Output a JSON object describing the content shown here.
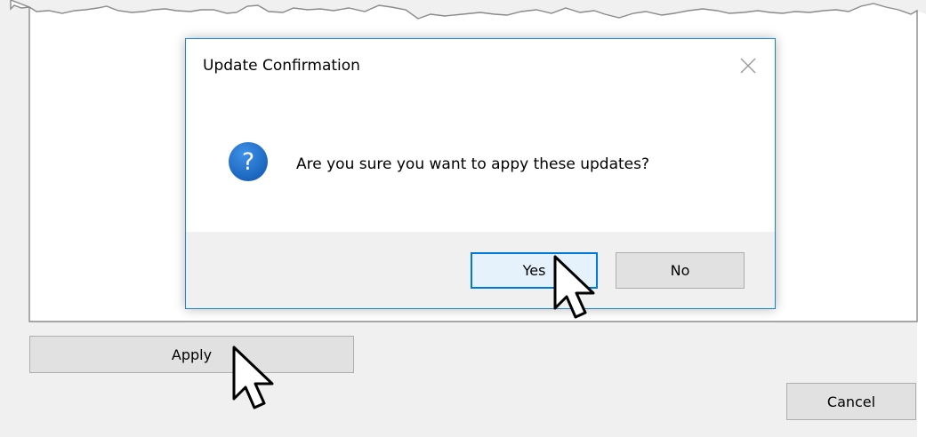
{
  "window": {
    "apply_label": "Apply",
    "cancel_label": "Cancel"
  },
  "dialog": {
    "title": "Update Confirmation",
    "close_icon": "close-icon",
    "icon": "question-icon",
    "icon_glyph": "?",
    "message": "Are you sure you want to appy these updates?",
    "yes_label": "Yes",
    "no_label": "No",
    "default_button": "Yes"
  },
  "colors": {
    "dialog_border": "#1883d7",
    "question_icon": "#1e6fd0",
    "default_button_border": "#0078d7",
    "button_face": "#e1e1e1",
    "footer": "#f0f0f0"
  }
}
